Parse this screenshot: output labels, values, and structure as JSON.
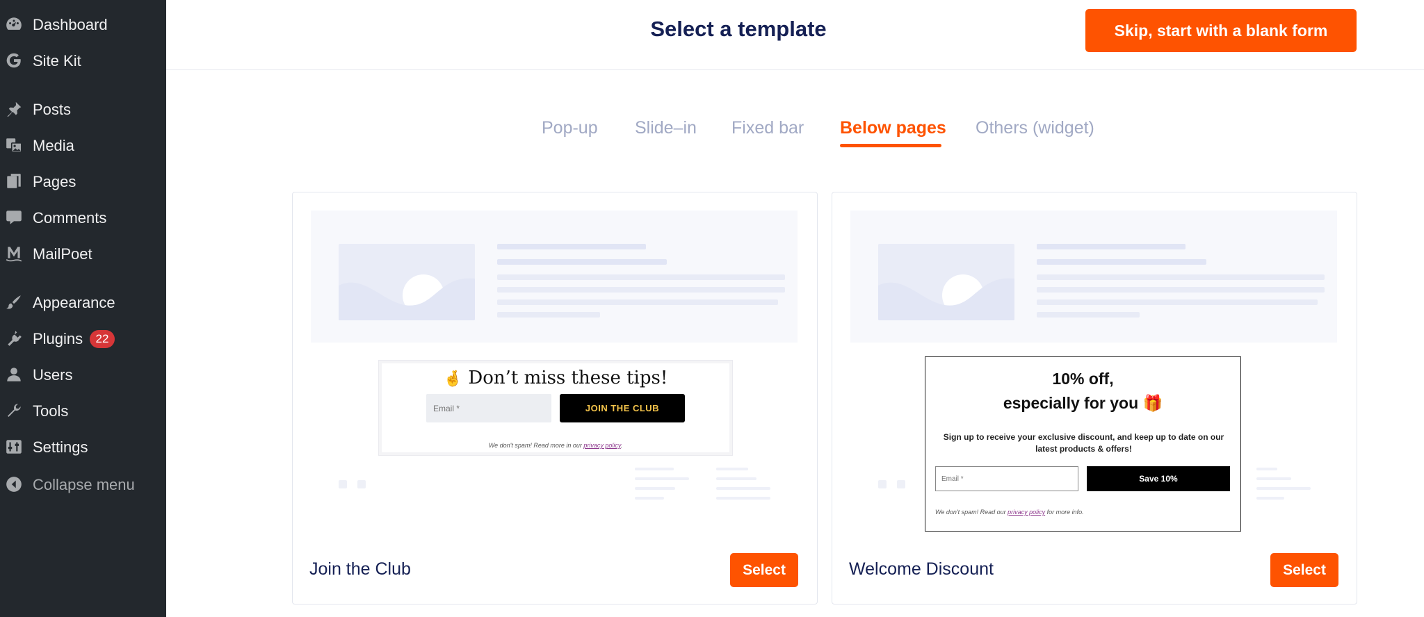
{
  "sidebar": {
    "items": [
      {
        "label": "Dashboard",
        "icon": "dashboard-icon"
      },
      {
        "label": "Site Kit",
        "icon": "google-g-icon"
      },
      {
        "label": "Posts",
        "icon": "pushpin-icon"
      },
      {
        "label": "Media",
        "icon": "media-icon"
      },
      {
        "label": "Pages",
        "icon": "pages-icon"
      },
      {
        "label": "Comments",
        "icon": "comment-icon"
      },
      {
        "label": "MailPoet",
        "icon": "mailpoet-icon"
      },
      {
        "label": "Appearance",
        "icon": "brush-icon"
      },
      {
        "label": "Plugins",
        "icon": "plugin-icon",
        "badge": "22"
      },
      {
        "label": "Users",
        "icon": "user-icon"
      },
      {
        "label": "Tools",
        "icon": "wrench-icon"
      },
      {
        "label": "Settings",
        "icon": "settings-icon"
      },
      {
        "label": "Collapse menu",
        "icon": "collapse-icon"
      }
    ]
  },
  "header": {
    "title": "Select a template",
    "skip_label": "Skip, start with a blank form"
  },
  "tabs": [
    {
      "label": "Pop-up",
      "active": false
    },
    {
      "label": "Slide–in",
      "active": false
    },
    {
      "label": "Fixed bar",
      "active": false
    },
    {
      "label": "Below pages",
      "active": true
    },
    {
      "label": "Others (widget)",
      "active": false
    }
  ],
  "templates": [
    {
      "name": "Join the Club",
      "select_label": "Select",
      "form": {
        "emoji": "🤞",
        "heading": "Don’t miss these tips!",
        "email_placeholder": "Email *",
        "submit_label": "JOIN THE CLUB",
        "note_prefix": "We don't spam! Read more in our ",
        "note_link": "privacy policy",
        "note_suffix": "."
      }
    },
    {
      "name": "Welcome Discount",
      "select_label": "Select",
      "form": {
        "heading_line1": "10% off,",
        "heading_line2": "especially for you 🎁",
        "body": "Sign up to receive your exclusive discount, and keep up to date on our latest products & offers!",
        "email_placeholder": "Email *",
        "submit_label": "Save 10%",
        "note_prefix": "We don't spam! Read our ",
        "note_link": "privacy policy",
        "note_suffix": " for more info."
      }
    }
  ],
  "colors": {
    "accent": "#fe5301",
    "sidebar_bg": "#23282d",
    "title": "#152054",
    "inactive_tab": "#a1a9c4",
    "badge": "#d63638"
  }
}
